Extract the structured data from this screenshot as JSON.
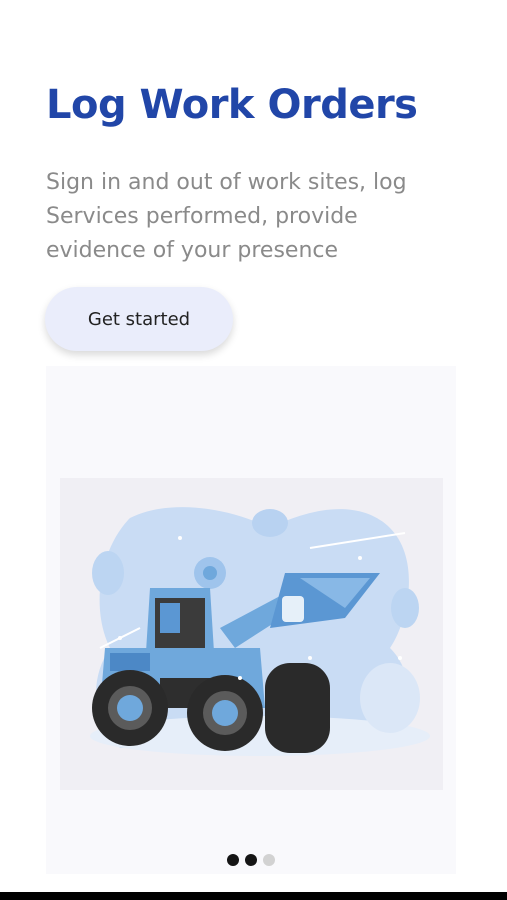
{
  "header": {
    "title": "Log Work Orders",
    "subtitle": "Sign in and out of work sites, log Services performed, provide evidence of your presence"
  },
  "actions": {
    "get_started_label": "Get started"
  },
  "hero": {
    "icon": "wheel-loader-illustration"
  },
  "pager": {
    "count": 3,
    "active": [
      0,
      1
    ]
  },
  "colors": {
    "title": "#2146a8",
    "subtitle": "#8a8a8a",
    "button_bg": "#eaedfb",
    "loader_blue": "#6fa8dc",
    "tire": "#2a2a2a"
  }
}
